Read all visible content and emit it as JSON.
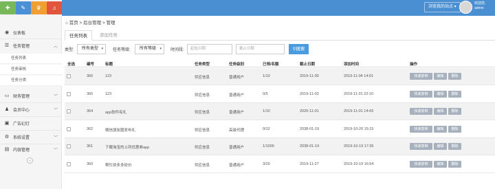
{
  "topbar": {
    "site_button": "浏览我的站点 ▾",
    "user_greeting": "欢迎您,",
    "username": "admin"
  },
  "top_icons": [
    "home-icon",
    "edit-icon",
    "shop-icon",
    "bell-icon"
  ],
  "sidebar": {
    "items": [
      {
        "label": "仪表板",
        "icon": "dashboard-icon"
      },
      {
        "label": "任务管理",
        "icon": "list-icon",
        "expanded": true,
        "children": [
          "任务列表",
          "任务审核",
          "任务分类"
        ]
      },
      {
        "label": "财务管理",
        "icon": "wallet-icon"
      },
      {
        "label": "会员中心",
        "icon": "user-icon"
      },
      {
        "label": "广告幻灯",
        "icon": "image-icon"
      },
      {
        "label": "系统设置",
        "icon": "gear-icon"
      },
      {
        "label": "内容管理",
        "icon": "folder-icon"
      }
    ],
    "collapse_symbol": "«"
  },
  "breadcrumb": "首页 > 后台管理 > 管理",
  "tabs": [
    "任务列表",
    "添加任务"
  ],
  "filters": {
    "type_label": "类型:",
    "type_value": "所有类型",
    "level_label": "任务等级:",
    "level_value": "所有等级",
    "time_label": "时间段:",
    "start_placeholder": "起始日期",
    "end_placeholder": "截止日期",
    "search_label": "搜索"
  },
  "table": {
    "headers": [
      "全选",
      "编号",
      "标题",
      "任务类型",
      "任务级别",
      "已领/名额",
      "截止日期",
      "添加时间",
      "操作"
    ],
    "actions": [
      "快速复制",
      "编辑",
      "删除"
    ],
    "rows": [
      {
        "id": "366",
        "title": "123",
        "type": "供应信息",
        "level": "普通用户",
        "quota": "1/10",
        "deadline": "2019-11-30",
        "added": "2019-11-04 14:01"
      },
      {
        "id": "365",
        "title": "123",
        "type": "供应信息",
        "level": "普通用户",
        "quota": "0/5",
        "deadline": "2019-11-03",
        "added": "2019-11-01 22:10"
      },
      {
        "id": "364",
        "title": "app软件有礼",
        "type": "供应信息",
        "level": "普通用户",
        "quota": "1/10",
        "deadline": "2020-11-01",
        "added": "2019-11-01 14:43"
      },
      {
        "id": "362",
        "title": "微信朋友圈发布礼",
        "type": "供应信息",
        "level": "高级代理",
        "quota": "0/12",
        "deadline": "2038-01-19",
        "added": "2019-10-20 15:15"
      },
      {
        "id": "361",
        "title": "下载淘宝的上所优惠券app",
        "type": "供应信息",
        "level": "普通用户",
        "quota": "1/1000",
        "deadline": "2038-01-19",
        "added": "2019-10-19 17:35"
      },
      {
        "id": "360",
        "title": "帮忙拼多多砍价",
        "type": "供应信息",
        "level": "普通用户",
        "quota": "3/20",
        "deadline": "2019-11-27",
        "added": "2019-10-19 16:54"
      }
    ]
  }
}
